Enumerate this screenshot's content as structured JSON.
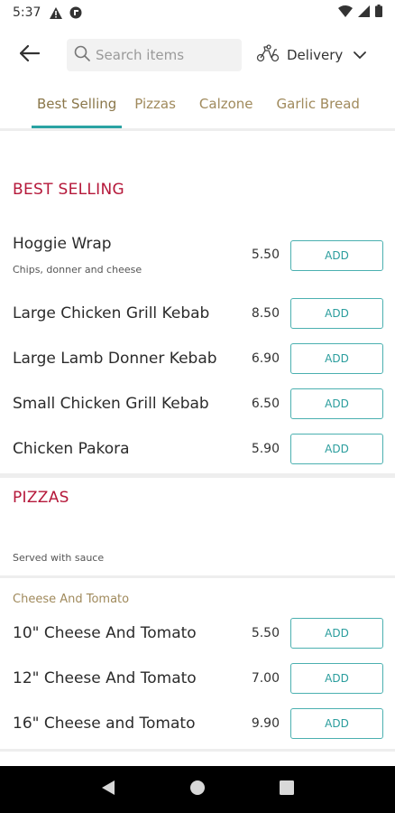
{
  "status_bar": {
    "time": "5:37"
  },
  "header": {
    "search_placeholder": "Search items",
    "delivery_label": "Delivery"
  },
  "tabs": [
    {
      "label": "Best Selling"
    },
    {
      "label": "Pizzas"
    },
    {
      "label": "Calzone"
    },
    {
      "label": "Garlic Bread"
    }
  ],
  "sections": {
    "best_selling": {
      "title": "BEST SELLING",
      "items": [
        {
          "name": "Hoggie Wrap",
          "desc": "Chips, donner and cheese",
          "price": "5.50",
          "add": "ADD"
        },
        {
          "name": "Large Chicken Grill Kebab",
          "price": "8.50",
          "add": "ADD"
        },
        {
          "name": "Large Lamb Donner Kebab",
          "price": "6.90",
          "add": "ADD"
        },
        {
          "name": "Small Chicken Grill Kebab",
          "price": "6.50",
          "add": "ADD"
        },
        {
          "name": "Chicken Pakora",
          "price": "5.90",
          "add": "ADD"
        }
      ]
    },
    "pizzas": {
      "title": "PIZZAS",
      "note": "Served with sauce",
      "subcategory": "Cheese And Tomato",
      "items": [
        {
          "name": "10\" Cheese And Tomato",
          "price": "5.50",
          "add": "ADD"
        },
        {
          "name": "12\" Cheese And Tomato",
          "price": "7.00",
          "add": "ADD"
        },
        {
          "name": "16\" Cheese and Tomato",
          "price": "9.90",
          "add": "ADD"
        }
      ]
    }
  },
  "icons": {
    "status": [
      "alert-icon",
      "vpn-icon",
      "wifi-icon",
      "signal-icon",
      "battery-icon"
    ],
    "header": [
      "back-arrow-icon",
      "search-icon",
      "scooter-icon",
      "chevron-down-icon"
    ],
    "nav": [
      "nav-back-icon",
      "nav-home-icon",
      "nav-recents-icon"
    ]
  },
  "colors": {
    "accent_teal": "#2aa3a3",
    "section_red": "#b5183a",
    "tab_gold": "#a08a5c"
  }
}
